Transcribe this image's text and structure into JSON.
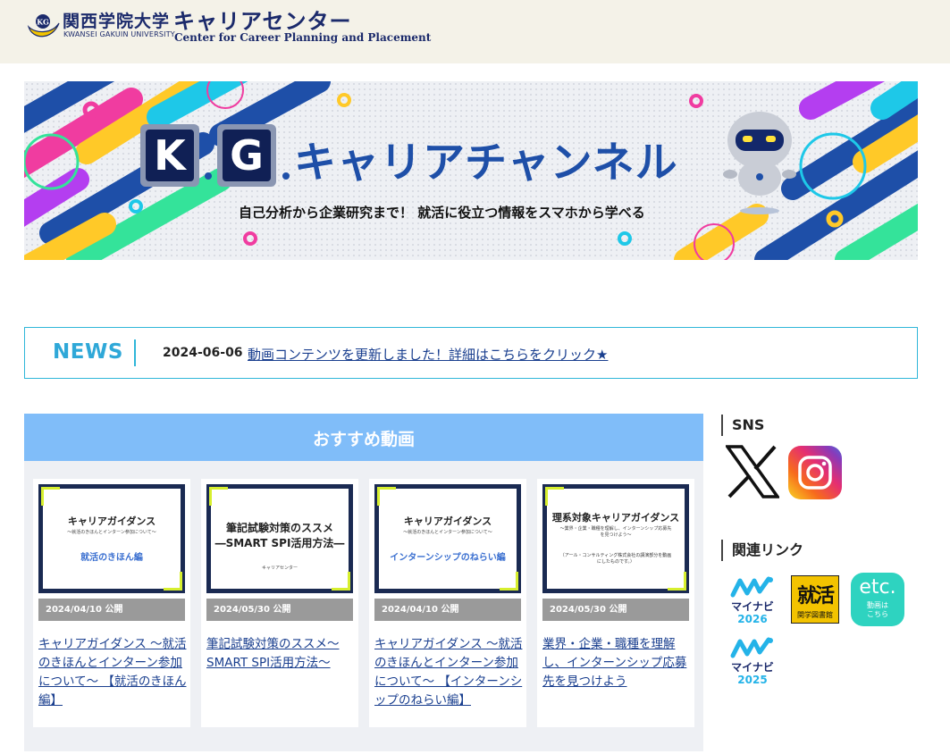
{
  "header": {
    "university_jp": "関西学院大学",
    "university_en": "KWANSEI GAKUIN UNIVERSITY",
    "center_jp": "キャリアセンター",
    "center_en": "Center for Career Planning and Placement"
  },
  "banner": {
    "letter_k": "K",
    "letter_g": "G",
    "title": "キャリアチャンネル",
    "subtitle": "自己分析から企業研究まで！ 就活に役立つ情報をスマホから学べる"
  },
  "news": {
    "label": "NEWS",
    "date": "2024-06-06",
    "link_text": "動画コンテンツを更新しました！詳細はこちらをクリック★"
  },
  "recommended": {
    "title": "おすすめ動画",
    "cards": [
      {
        "thumb_title": "キャリアガイダンス",
        "thumb_sub": "～就活のきほんとインターン参加について～",
        "thumb_highlight": "就活のきほん編",
        "date": "2024/04/10 公開",
        "link": "キャリアガイダンス ～就活のきほんとインターン参加について～ 【就活のきほん編】"
      },
      {
        "thumb_title": "筆記試験対策のススメ\n―SMART SPI活用方法―",
        "thumb_sub": "キャリアセンター",
        "thumb_highlight": "",
        "date": "2024/05/30 公開",
        "link": "筆記試験対策のススメ～SMART SPI活用方法～"
      },
      {
        "thumb_title": "キャリアガイダンス",
        "thumb_sub": "～就活のきほんとインターン参加について～",
        "thumb_highlight": "インターンシップのねらい編",
        "date": "2024/04/10 公開",
        "link": "キャリアガイダンス ～就活のきほんとインターン参加について～ 【インターンシップのねらい編】"
      },
      {
        "thumb_title": "理系対象キャリアガイダンス",
        "thumb_sub": "～業界・企業・職種を理解し、インターンシップ応募先を見つけよう～",
        "thumb_highlight": "（アール・コンサルティング株式会社の講演部分を動画にしたものです。）",
        "date": "2024/05/30 公開",
        "link": "業界・企業・職種を理解し、インターンシップ応募先を見つけよう"
      }
    ]
  },
  "sidebar": {
    "sns_heading": "SNS",
    "links_heading": "関連リンク",
    "mynavi_2026_name": "マイナビ",
    "mynavi_2026_year": "2026",
    "shukatsu_glyph": "就活",
    "shukatsu_caption": "関学図書館",
    "etc_main": "etc.",
    "etc_sub": "動画は\nこちら",
    "mynavi_2025_name": "マイナビ",
    "mynavi_2025_year": "2025"
  },
  "colors": {
    "header_bg": "#f4f2e8",
    "brand_navy": "#1b2a6b",
    "news_accent": "#2fb6d9",
    "rec_title_bg": "#80bdf9",
    "link_blue": "#1a3f8f",
    "date_bar": "#9a9a9a",
    "etc_teal": "#2ed3c0"
  }
}
